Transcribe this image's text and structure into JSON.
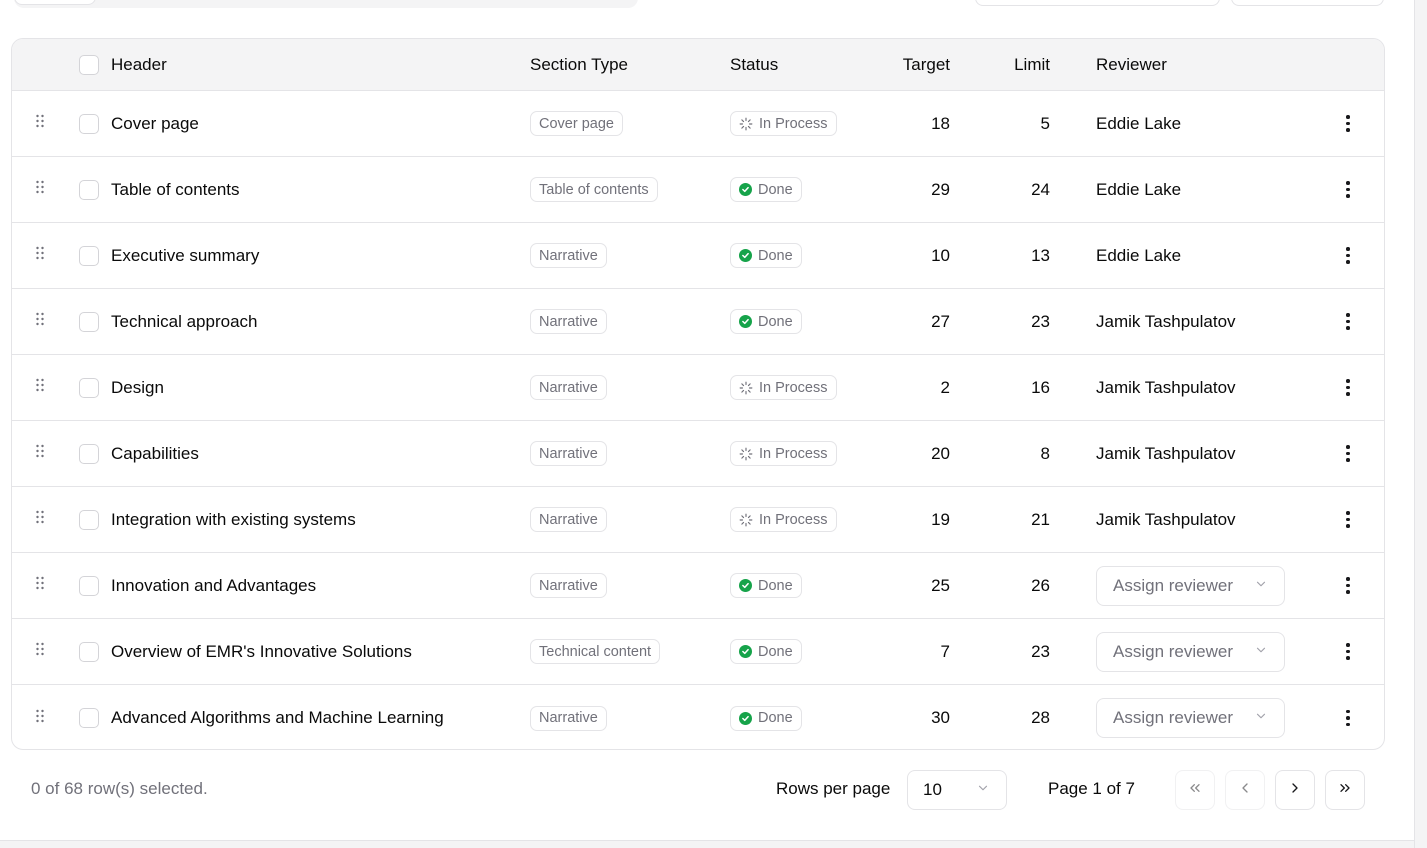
{
  "table": {
    "columns": {
      "header": "Header",
      "section_type": "Section Type",
      "status": "Status",
      "target": "Target",
      "limit": "Limit",
      "reviewer": "Reviewer"
    },
    "rows": [
      {
        "header": "Cover page",
        "type": "Cover page",
        "status": "In Process",
        "target": "18",
        "limit": "5",
        "reviewer": "Eddie Lake"
      },
      {
        "header": "Table of contents",
        "type": "Table of contents",
        "status": "Done",
        "target": "29",
        "limit": "24",
        "reviewer": "Eddie Lake"
      },
      {
        "header": "Executive summary",
        "type": "Narrative",
        "status": "Done",
        "target": "10",
        "limit": "13",
        "reviewer": "Eddie Lake"
      },
      {
        "header": "Technical approach",
        "type": "Narrative",
        "status": "Done",
        "target": "27",
        "limit": "23",
        "reviewer": "Jamik Tashpulatov"
      },
      {
        "header": "Design",
        "type": "Narrative",
        "status": "In Process",
        "target": "2",
        "limit": "16",
        "reviewer": "Jamik Tashpulatov"
      },
      {
        "header": "Capabilities",
        "type": "Narrative",
        "status": "In Process",
        "target": "20",
        "limit": "8",
        "reviewer": "Jamik Tashpulatov"
      },
      {
        "header": "Integration with existing systems",
        "type": "Narrative",
        "status": "In Process",
        "target": "19",
        "limit": "21",
        "reviewer": "Jamik Tashpulatov"
      },
      {
        "header": "Innovation and Advantages",
        "type": "Narrative",
        "status": "Done",
        "target": "25",
        "limit": "26",
        "reviewer": ""
      },
      {
        "header": "Overview of EMR's Innovative Solutions",
        "type": "Technical content",
        "status": "Done",
        "target": "7",
        "limit": "23",
        "reviewer": ""
      },
      {
        "header": "Advanced Algorithms and Machine Learning",
        "type": "Narrative",
        "status": "Done",
        "target": "30",
        "limit": "28",
        "reviewer": ""
      }
    ],
    "assign_placeholder": "Assign reviewer"
  },
  "footer": {
    "selection": "0 of 68 row(s) selected.",
    "rows_per_page_label": "Rows per page",
    "rows_per_page_value": "10",
    "page_label": "Page 1 of 7"
  },
  "colors": {
    "done": "#16a34a",
    "header_bg": "#f4f4f5",
    "border": "#e4e4e7",
    "muted_text": "#71717a"
  },
  "icons": {
    "drag": "grip-vertical-icon",
    "done": "check-circle-icon",
    "in_process": "loader-icon",
    "row_menu": "more-vertical-icon",
    "select": "chevron-down-icon",
    "first": "chevrons-left-icon",
    "prev": "chevron-left-icon",
    "next": "chevron-right-icon",
    "last": "chevrons-right-icon"
  }
}
